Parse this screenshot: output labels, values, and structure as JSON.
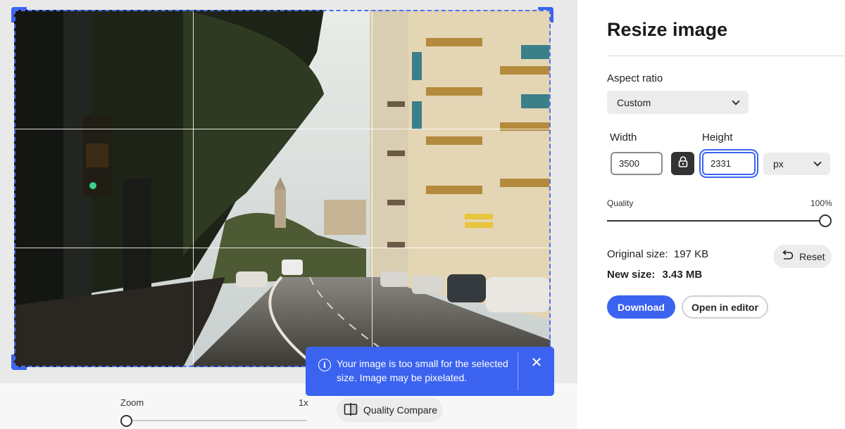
{
  "panel": {
    "title": "Resize image",
    "aspect_ratio": {
      "label": "Aspect ratio",
      "value": "Custom"
    },
    "width": {
      "label": "Width",
      "value": "3500"
    },
    "height": {
      "label": "Height",
      "value": "2331"
    },
    "unit": {
      "value": "px"
    },
    "quality": {
      "label": "Quality",
      "value_text": "100%",
      "level": 1.0
    },
    "original_size": {
      "label": "Original size:",
      "value": "197 KB"
    },
    "new_size": {
      "label": "New size:",
      "value": "3.43 MB"
    },
    "reset_label": "Reset",
    "download_label": "Download",
    "open_editor_label": "Open in editor"
  },
  "toast": {
    "message": "Your image is too small for the selected size. Image may be pixelated.",
    "icon": "info-icon"
  },
  "bottom": {
    "zoom_label": "Zoom",
    "zoom_value": "1x",
    "zoom_level": 0.0,
    "compare_label": "Quality Compare"
  },
  "colors": {
    "accent": "#3b63f0",
    "canvas_bg": "#e9e9e9"
  }
}
